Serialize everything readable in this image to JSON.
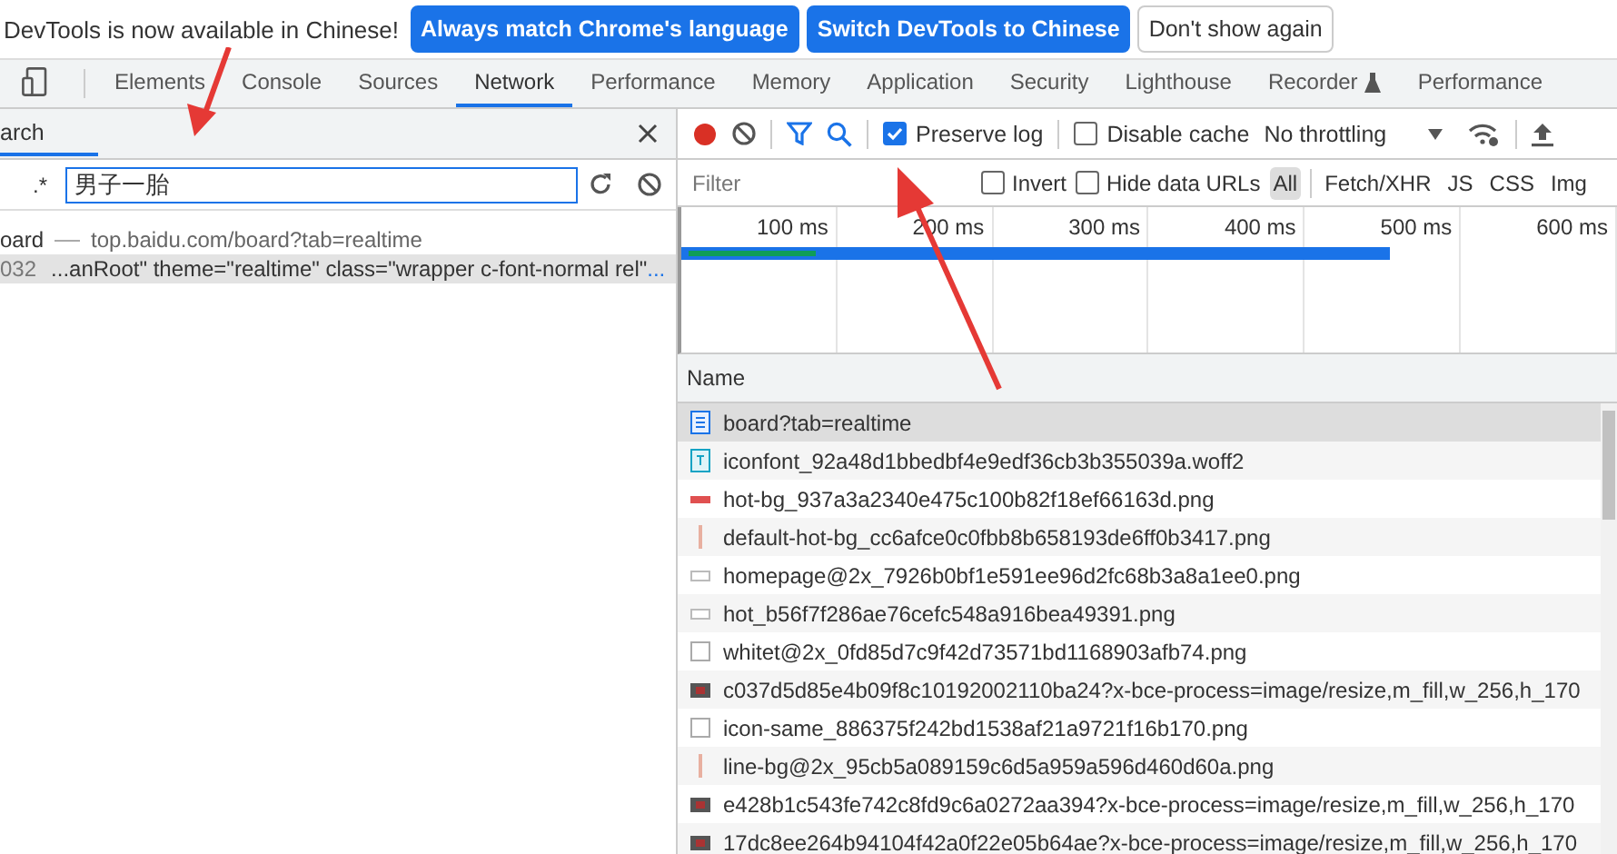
{
  "infobar": {
    "message": "DevTools is now available in Chinese!",
    "buttons": [
      {
        "label": "Always match Chrome's language",
        "kind": "primary"
      },
      {
        "label": "Switch DevTools to Chinese",
        "kind": "primary"
      },
      {
        "label": "Don't show again",
        "kind": "plain"
      }
    ]
  },
  "tabs": [
    {
      "label": "Elements",
      "selected": false
    },
    {
      "label": "Console",
      "selected": false
    },
    {
      "label": "Sources",
      "selected": false
    },
    {
      "label": "Network",
      "selected": true
    },
    {
      "label": "Performance",
      "selected": false
    },
    {
      "label": "Memory",
      "selected": false
    },
    {
      "label": "Application",
      "selected": false
    },
    {
      "label": "Security",
      "selected": false
    },
    {
      "label": "Lighthouse",
      "selected": false
    },
    {
      "label": "Recorder",
      "selected": false,
      "experimental": true
    },
    {
      "label": "Performance",
      "selected": false
    }
  ],
  "search_panel": {
    "title": "arch",
    "regex_label": ".*",
    "query": "男子一胎",
    "results": [
      {
        "kind": "file",
        "name": "oard",
        "url": "top.baidu.com/board?tab=realtime",
        "selected": false
      },
      {
        "kind": "match",
        "line": "032",
        "text": "...anRoot\" theme=\"realtime\" class=\"wrapper c-font-normal rel\"",
        "more": "...",
        "selected": true
      }
    ]
  },
  "toolbar": {
    "recording": true,
    "filter_active": true,
    "search_active": true,
    "preserve_log": {
      "label": "Preserve log",
      "checked": true
    },
    "disable_cache": {
      "label": "Disable cache",
      "checked": false
    },
    "throttling": "No throttling"
  },
  "filter_bar": {
    "placeholder": "Filter",
    "invert": {
      "label": "Invert",
      "checked": false
    },
    "hide_data_urls": {
      "label": "Hide data URLs",
      "checked": false
    },
    "types": [
      {
        "label": "All",
        "selected": true
      },
      {
        "label": "Fetch/XHR",
        "selected": false
      },
      {
        "label": "JS",
        "selected": false
      },
      {
        "label": "CSS",
        "selected": false
      },
      {
        "label": "Img",
        "selected": false
      }
    ]
  },
  "overview": {
    "ticks": [
      "100 ms",
      "200 ms",
      "300 ms",
      "400 ms",
      "500 ms",
      "600 ms"
    ]
  },
  "table": {
    "column": "Name",
    "rows": [
      {
        "name": "board?tab=realtime",
        "kind": "document",
        "selected": true
      },
      {
        "name": "iconfont_92a48d1bbedbf4e9edf36cb3b355039a.woff2",
        "kind": "font",
        "selected": false
      },
      {
        "name": "hot-bg_937a3a2340e475c100b82f18ef66163d.png",
        "kind": "stripe",
        "selected": false
      },
      {
        "name": "default-hot-bg_cc6afce0c0fbb8b658193de6ff0b3417.png",
        "kind": "thin",
        "selected": false
      },
      {
        "name": "homepage@2x_7926b0bf1e591ee96d2fc68b3a8a1ee0.png",
        "kind": "blank",
        "selected": false
      },
      {
        "name": "hot_b56f7f286ae76cefc548a916bea49391.png",
        "kind": "blank",
        "selected": false
      },
      {
        "name": "whitet@2x_0fd85d7c9f42d73571bd1168903afb74.png",
        "kind": "square",
        "selected": false
      },
      {
        "name": "c037d5d85e4b09f8c10192002110ba24?x-bce-process=image/resize,m_fill,w_256,h_170",
        "kind": "photo",
        "selected": false
      },
      {
        "name": "icon-same_886375f242bd1538af21a9721f16b170.png",
        "kind": "square",
        "selected": false
      },
      {
        "name": "line-bg@2x_95cb5a089159c6d5a959a596d460d60a.png",
        "kind": "thin",
        "selected": false
      },
      {
        "name": "e428b1c543fe742c8fd9c6a0272aa394?x-bce-process=image/resize,m_fill,w_256,h_170",
        "kind": "photo",
        "selected": false
      },
      {
        "name": "17dc8ee264b94104f42a0f22e05b64ae?x-bce-process=image/resize,m_fill,w_256,h_170",
        "kind": "photo",
        "selected": false
      }
    ]
  }
}
